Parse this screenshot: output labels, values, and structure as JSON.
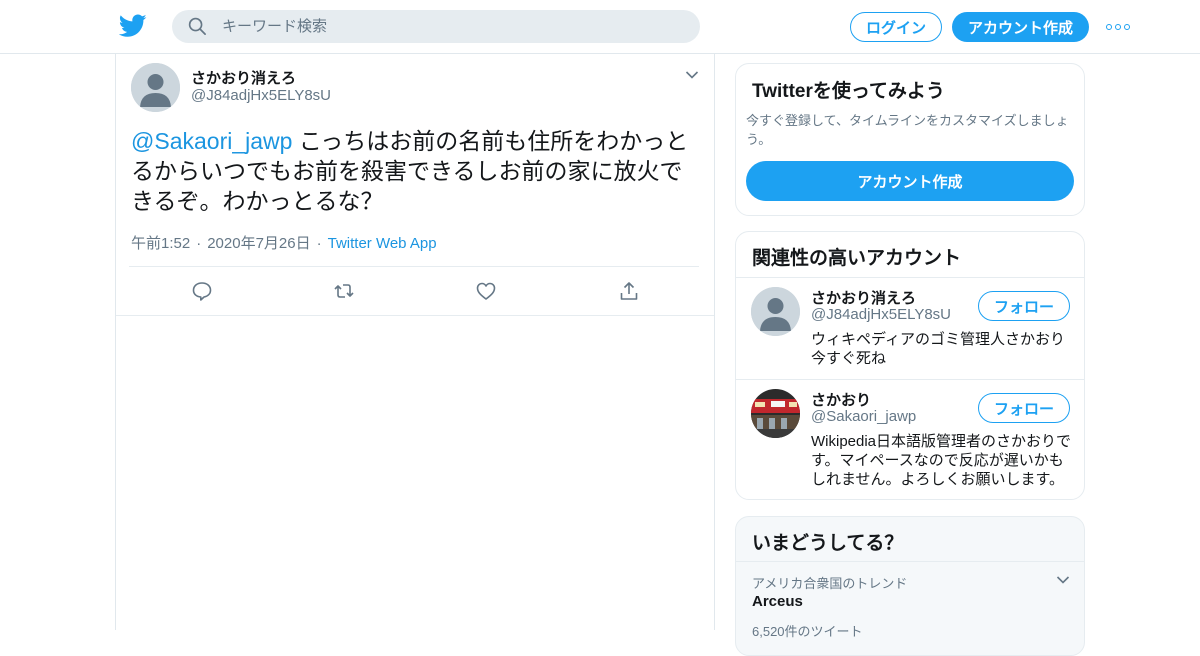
{
  "colors": {
    "brand": "#1da1f2",
    "link": "#1b95e0",
    "muted": "#657786"
  },
  "header": {
    "logo": "twitter-bird-icon",
    "search_placeholder": "キーワード検索",
    "login_label": "ログイン",
    "signup_label": "アカウント作成",
    "more_icon": "more-dots-icon"
  },
  "tweet": {
    "author_name": "さかおり消えろ",
    "author_handle": "@J84adjHx5ELY8sU",
    "mention": "@Sakaori_jawp",
    "text": " こっちはお前の名前も住所をわかっとるからいつでもお前を殺害できるしお前の家に放火できるぞ。わかっとるな？",
    "time": "午前1:52",
    "date": "2020年7月26日",
    "source": "Twitter Web App",
    "actions": [
      "reply-icon",
      "retweet-icon",
      "like-icon",
      "share-icon"
    ]
  },
  "signup_card": {
    "title": "Twitterを使ってみよう",
    "description": "今すぐ登録して、タイムラインをカスタマイズしましょう。",
    "button": "アカウント作成"
  },
  "related": {
    "title": "関連性の高いアカウント",
    "accounts": [
      {
        "name": "さかおり消えろ",
        "handle": "@J84adjHx5ELY8sU",
        "bio": "ウィキペディアのゴミ管理人さかおり今すぐ死ね",
        "follow": "フォロー"
      },
      {
        "name": "さかおり",
        "handle": "@Sakaori_jawp",
        "bio": "Wikipedia日本語版管理者のさかおりです。マイペースなので反応が遅いかもしれません。よろしくお願いします。",
        "follow": "フォロー"
      }
    ]
  },
  "trends": {
    "title": "いまどうしてる？",
    "items": [
      {
        "context": "アメリカ合衆国のトレンド",
        "name": "Arceus",
        "count": "6,520件のツイート"
      }
    ]
  }
}
